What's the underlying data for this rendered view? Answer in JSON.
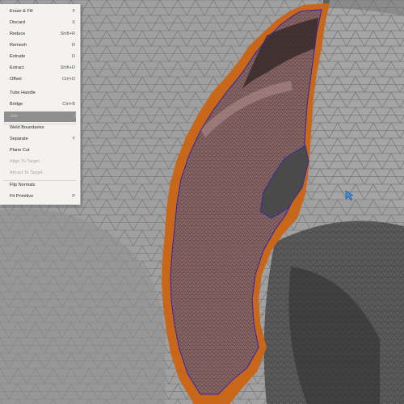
{
  "menu": {
    "items": [
      {
        "label": "Erase & Fill",
        "shortcut": "F",
        "state": "normal"
      },
      {
        "label": "Discard",
        "shortcut": "X",
        "state": "normal"
      },
      {
        "label": "Reduce",
        "shortcut": "Shift+R",
        "state": "normal"
      },
      {
        "label": "Remesh",
        "shortcut": "R",
        "state": "normal"
      },
      {
        "label": "Extrude",
        "shortcut": "D",
        "state": "normal"
      },
      {
        "label": "Extract",
        "shortcut": "Shift+D",
        "state": "normal"
      },
      {
        "label": "Offset",
        "shortcut": "Ctrl+D",
        "state": "normal"
      },
      {
        "label": "Tube Handle",
        "shortcut": "",
        "state": "normal"
      },
      {
        "label": "Bridge",
        "shortcut": "Ctrl+B",
        "state": "normal"
      },
      {
        "label": "Join",
        "shortcut": "J",
        "state": "highlighted"
      },
      {
        "label": "Weld Boundaries",
        "shortcut": "",
        "state": "normal"
      },
      {
        "label": "Separate",
        "shortcut": "Y",
        "state": "normal"
      },
      {
        "label": "Plane Cut",
        "shortcut": "",
        "state": "normal"
      },
      {
        "label": "Align To Target",
        "shortcut": "",
        "state": "disabled"
      },
      {
        "label": "Attract To Target",
        "shortcut": "",
        "state": "disabled"
      },
      {
        "label": "Flip Normals",
        "shortcut": "",
        "state": "normal"
      },
      {
        "label": "Fit Primitive",
        "shortcut": "P",
        "state": "normal"
      }
    ]
  },
  "colors": {
    "mesh_background": "#9c9c9c",
    "wire": "#6e6e6e",
    "selection_border": "#c8661a",
    "selected_region": "#8a6666",
    "boundary_loop": "#3a2aa0",
    "cursor": "#3a8fd8",
    "menu_background": "#f3f2ef",
    "menu_highlight": "#8e8e8e"
  },
  "icons": {
    "cursor": "arrow-cursor-icon"
  }
}
